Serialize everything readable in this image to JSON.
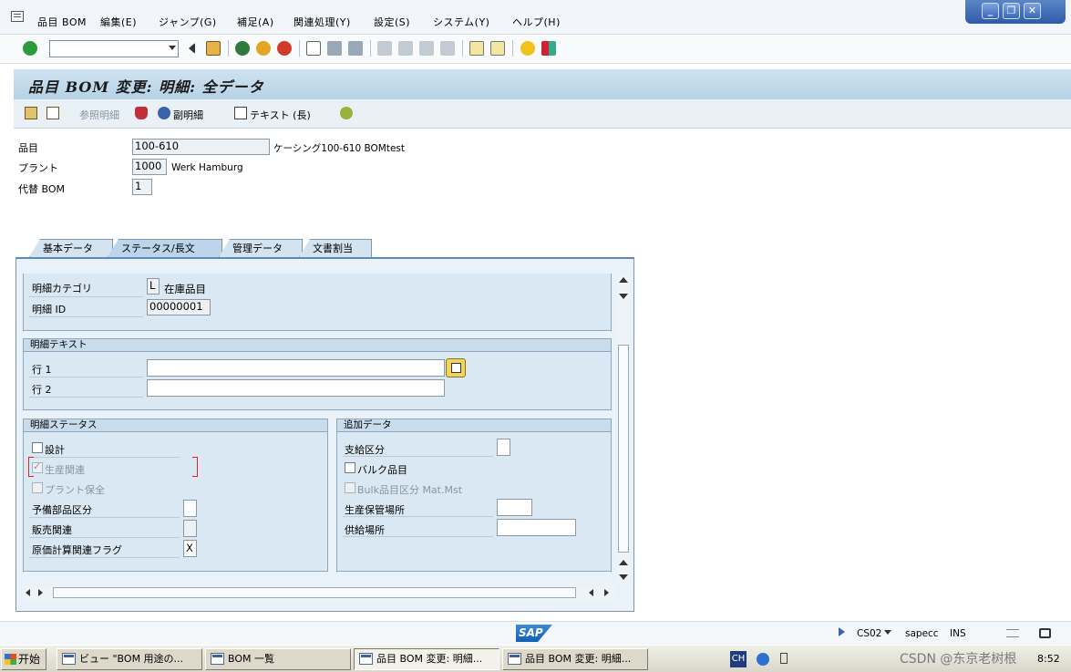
{
  "menu": {
    "items": [
      "品目 BOM",
      "編集(E)",
      "ジャンプ(G)",
      "補足(A)",
      "関連処理(Y)",
      "設定(S)",
      "システム(Y)",
      "ヘルプ(H)"
    ]
  },
  "toolbar": {
    "command_value": ""
  },
  "title": "品目 BOM 変更: 明細: 全データ",
  "app_toolbar": {
    "ref_item": "参照明細",
    "sub_item": "副明細",
    "long_text": "テキスト (長)"
  },
  "header": {
    "material_label": "品目",
    "material_value": "100-610",
    "material_desc": "ケーシング100-610 BOMtest",
    "plant_label": "プラント",
    "plant_value": "1000",
    "plant_desc": "Werk Hamburg",
    "alt_bom_label": "代替 BOM",
    "alt_bom_value": "1"
  },
  "tabs": [
    {
      "label": "基本データ",
      "active": false
    },
    {
      "label": "ステータス/長文",
      "active": true
    },
    {
      "label": "管理データ",
      "active": false
    },
    {
      "label": "文書割当",
      "active": false
    }
  ],
  "item_info": {
    "category_label": "明細カテゴリ",
    "category_value": "L",
    "category_desc": "在庫品目",
    "id_label": "明細 ID",
    "id_value": "00000001"
  },
  "item_text": {
    "heading": "明細テキスト",
    "line1_label": "行 1",
    "line1_value": "",
    "line2_label": "行 2",
    "line2_value": ""
  },
  "item_status": {
    "heading": "明細ステータス",
    "design_label": "設計",
    "design_checked": false,
    "production_label": "生産関連",
    "production_checked": true,
    "plant_maint_label": "プラント保全",
    "plant_maint_checked": false,
    "spare_label": "予備部品区分",
    "spare_value": "",
    "sales_label": "販売関連",
    "sales_value": "",
    "costing_label": "原価計算関連フラグ",
    "costing_value": "X"
  },
  "additional": {
    "heading": "追加データ",
    "supply_label": "支給区分",
    "supply_value": "",
    "bulk_label": "バルク品目",
    "bulk_checked": false,
    "bulk_mm_label": "Bulk品目区分 Mat.Mst",
    "prod_storage_label": "生産保管場所",
    "prod_storage_value": "",
    "supply_area_label": "供給場所",
    "supply_area_value": ""
  },
  "status": {
    "transaction": "CS02",
    "system": "sapecc",
    "mode": "INS"
  },
  "taskbar": {
    "start": "开始",
    "items": [
      "ビュー \"BOM 用途の...",
      "BOM 一覧",
      "品目 BOM 変更: 明細...",
      "品目 BOM 変更: 明細..."
    ],
    "ime": "CH",
    "watermark": "CSDN @东京老树根",
    "time": "8:52"
  }
}
